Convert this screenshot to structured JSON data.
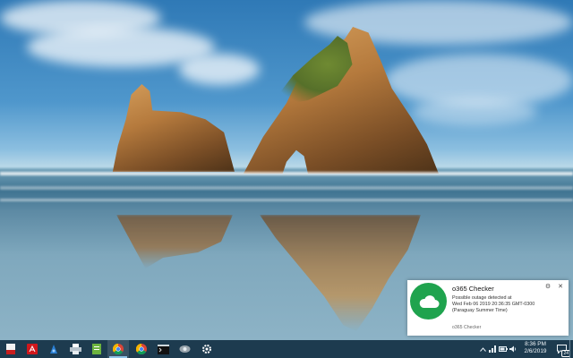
{
  "notification": {
    "title": "o365 Checker",
    "body_line1": "Possible outage detected at",
    "body_line2": "Wed Feb 06 2019 20:36:35 GMT-0300",
    "body_line3": "(Paraguay Summer Time)",
    "footer": "o365 Checker",
    "settings_glyph": "⚙",
    "close_glyph": "✕",
    "app_icon": "cloud-icon",
    "accent_color": "#1fa34e"
  },
  "taskbar": {
    "apps": [
      {
        "name": "pdf-tool-icon",
        "color": "#c81e1e"
      },
      {
        "name": "acrobat-reader-icon",
        "color": "#d0171c"
      },
      {
        "name": "paint-icon",
        "color": "#2a7fd4"
      },
      {
        "name": "printer-icon",
        "color": "#b7c3cc"
      },
      {
        "name": "notepad-icon",
        "color": "#6db33f"
      },
      {
        "name": "chrome-icon",
        "active": true
      },
      {
        "name": "chrome-icon"
      },
      {
        "name": "terminal-icon",
        "color": "#111111"
      },
      {
        "name": "network-tool-icon",
        "color": "#9aa5ad"
      },
      {
        "name": "settings-gear-icon",
        "color": "#ffffff"
      }
    ],
    "tray": {
      "chevron_icon": "chevron-up-icon",
      "icons": [
        "network-icon",
        "battery-icon",
        "speaker-icon",
        "monitor-icon"
      ]
    },
    "clock": {
      "time": "8:36 PM",
      "date": "2/6/2019"
    },
    "action_center_badge": "24"
  }
}
